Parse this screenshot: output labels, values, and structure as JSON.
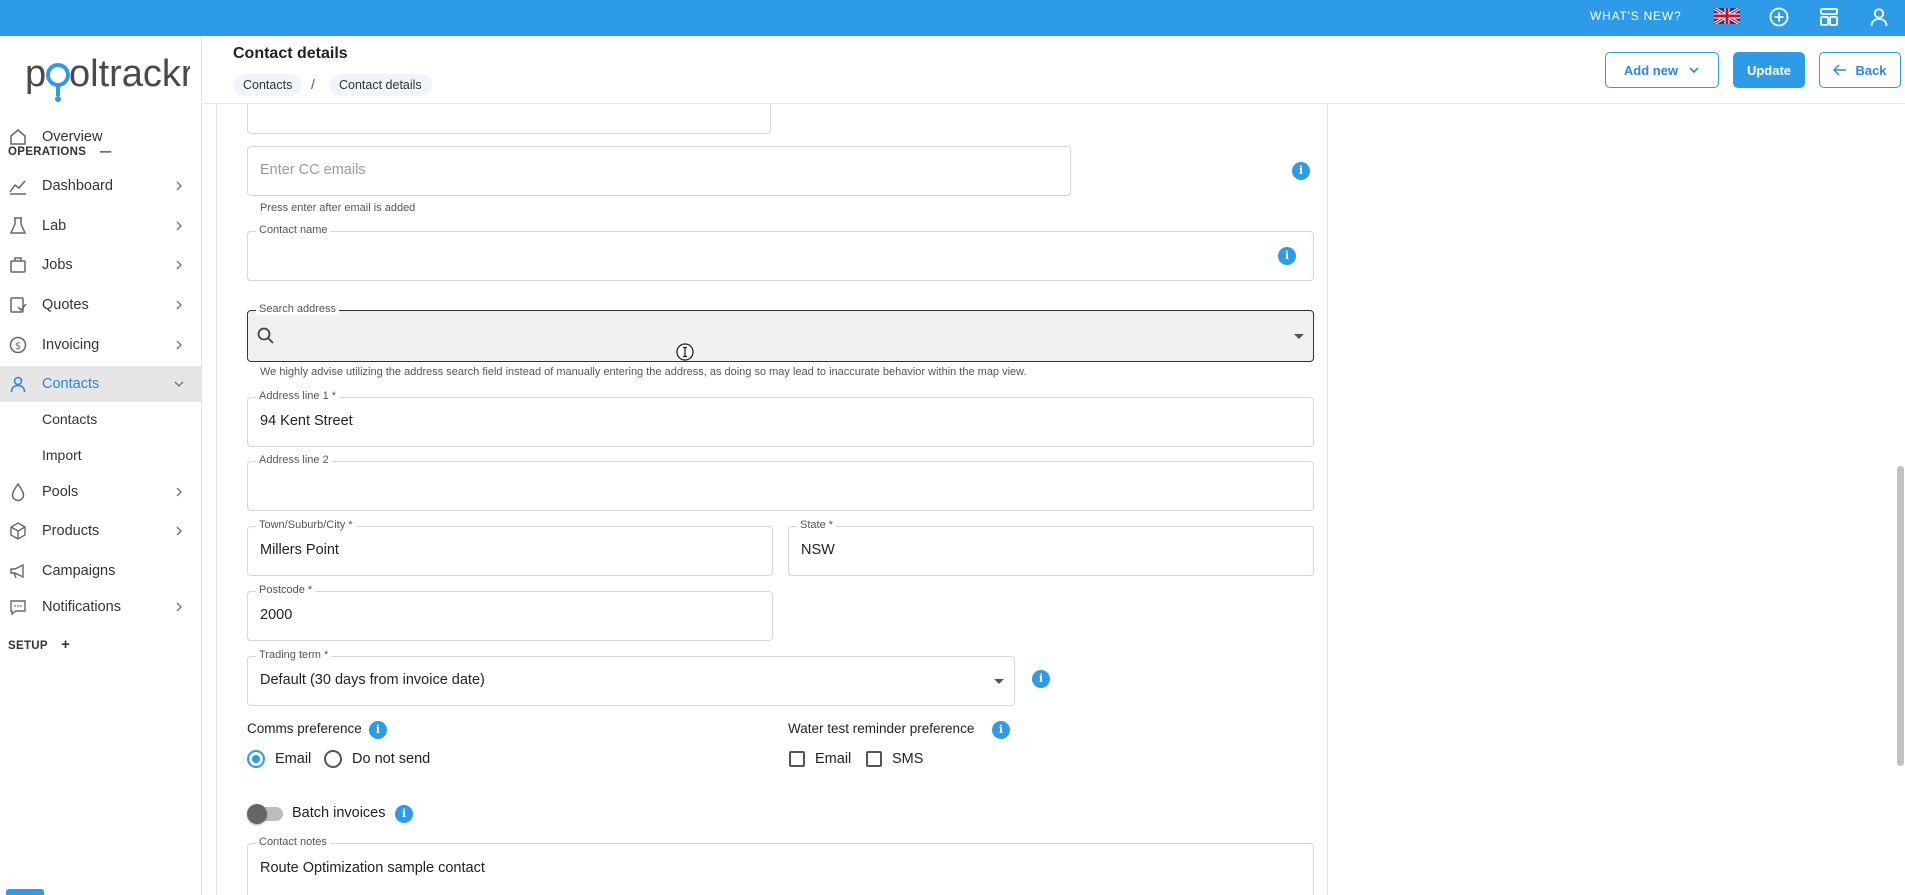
{
  "topbar": {
    "whats_new": "WHAT'S NEW?",
    "icons": [
      "uk-flag-icon",
      "add-circle-icon",
      "layout-icon",
      "user-icon"
    ],
    "color": "#2e9be8"
  },
  "logo": {
    "text_pre": "p",
    "text_o": "o",
    "text_post": "oltrackr",
    "accent": "#2e9be8"
  },
  "sidebar": {
    "overview": "Overview",
    "operations": "OPERATIONS",
    "operations_toggle": "—",
    "items": [
      {
        "label": "Dashboard",
        "icon": "chart-line-icon"
      },
      {
        "label": "Lab",
        "icon": "flask-icon"
      },
      {
        "label": "Jobs",
        "icon": "briefcase-icon"
      },
      {
        "label": "Quotes",
        "icon": "quote-icon"
      },
      {
        "label": "Invoicing",
        "icon": "dollar-icon"
      },
      {
        "label": "Contacts",
        "icon": "person-icon"
      }
    ],
    "contacts_sub": [
      "Contacts",
      "Import"
    ],
    "items2": [
      {
        "label": "Pools",
        "icon": "drop-icon"
      },
      {
        "label": "Products",
        "icon": "box-icon"
      },
      {
        "label": "Campaigns",
        "icon": "megaphone-icon"
      },
      {
        "label": "Notifications",
        "icon": "chat-icon"
      }
    ],
    "setup": "SETUP",
    "setup_toggle": "+"
  },
  "header": {
    "title": "Contact details",
    "breadcrumb": [
      "Contacts",
      "Contact details"
    ],
    "breadcrumb_sep": "/",
    "add_new": "Add new",
    "update": "Update",
    "back": "Back"
  },
  "form": {
    "cc_placeholder": "Enter CC emails",
    "cc_helper": "Press enter after email is added",
    "contact_name_label": "Contact name",
    "contact_name_value": "",
    "search_address_label": "Search address",
    "search_address_value": "",
    "search_helper": "We highly advise utilizing the address search field instead of manually entering the address, as doing so may lead to inaccurate behavior within the map view.",
    "address1_label": "Address line 1 *",
    "address1_value": "94 Kent Street",
    "address2_label": "Address line 2",
    "address2_value": "",
    "town_label": "Town/Suburb/City *",
    "town_value": "Millers Point",
    "state_label": "State *",
    "state_value": "NSW",
    "postcode_label": "Postcode *",
    "postcode_value": "2000",
    "trading_label": "Trading term *",
    "trading_value": "Default (30 days from invoice date)",
    "comms_label": "Comms preference",
    "comms_options": [
      "Email",
      "Do not send"
    ],
    "comms_selected": "Email",
    "water_label": "Water test reminder preference",
    "water_options": [
      "Email",
      "SMS"
    ],
    "batch_label": "Batch invoices",
    "batch_on": false,
    "notes_label": "Contact notes",
    "notes_value": "Route Optimization sample contact",
    "info_glyph": "i"
  }
}
